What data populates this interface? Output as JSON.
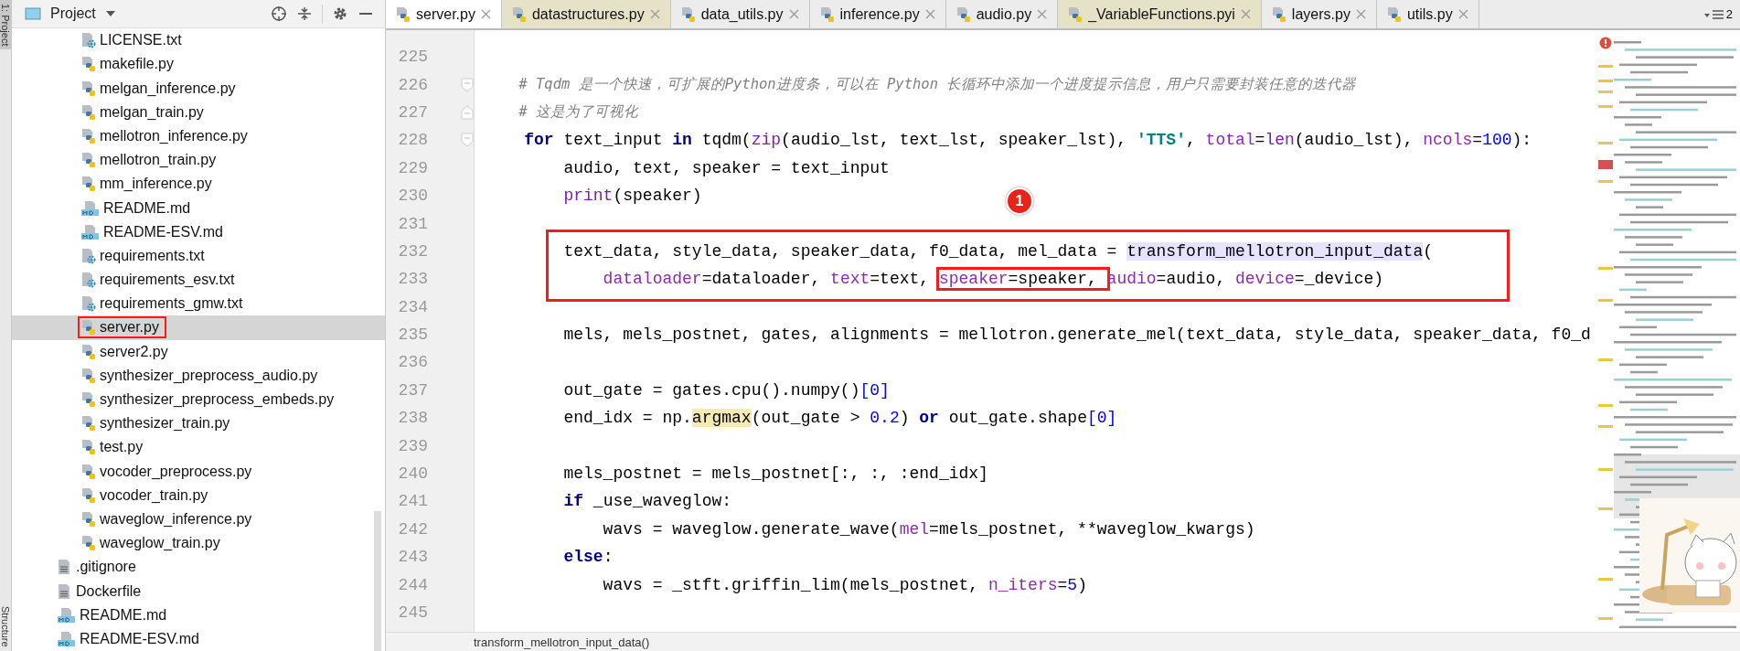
{
  "tool_strip": {
    "top_label": "1: Project",
    "bottom_label": "Structure"
  },
  "project_panel": {
    "title": "Project",
    "inner_items": [
      {
        "label": "LICENSE.txt",
        "kind": "config",
        "selected": false,
        "boxed": false
      },
      {
        "label": "makefile.py",
        "kind": "python",
        "selected": false,
        "boxed": false
      },
      {
        "label": "melgan_inference.py",
        "kind": "python",
        "selected": false,
        "boxed": false
      },
      {
        "label": "melgan_train.py",
        "kind": "python",
        "selected": false,
        "boxed": false
      },
      {
        "label": "mellotron_inference.py",
        "kind": "python",
        "selected": false,
        "boxed": false
      },
      {
        "label": "mellotron_train.py",
        "kind": "python",
        "selected": false,
        "boxed": false
      },
      {
        "label": "mm_inference.py",
        "kind": "python",
        "selected": false,
        "boxed": false
      },
      {
        "label": "README.md",
        "kind": "markdown",
        "selected": false,
        "boxed": false
      },
      {
        "label": "README-ESV.md",
        "kind": "markdown",
        "selected": false,
        "boxed": false
      },
      {
        "label": "requirements.txt",
        "kind": "config",
        "selected": false,
        "boxed": false
      },
      {
        "label": "requirements_esv.txt",
        "kind": "config",
        "selected": false,
        "boxed": false
      },
      {
        "label": "requirements_gmw.txt",
        "kind": "config",
        "selected": false,
        "boxed": false
      },
      {
        "label": "server.py",
        "kind": "python",
        "selected": true,
        "boxed": true
      },
      {
        "label": "server2.py",
        "kind": "python",
        "selected": false,
        "boxed": false
      },
      {
        "label": "synthesizer_preprocess_audio.py",
        "kind": "python",
        "selected": false,
        "boxed": false
      },
      {
        "label": "synthesizer_preprocess_embeds.py",
        "kind": "python",
        "selected": false,
        "boxed": false
      },
      {
        "label": "synthesizer_train.py",
        "kind": "python",
        "selected": false,
        "boxed": false
      },
      {
        "label": "test.py",
        "kind": "python",
        "selected": false,
        "boxed": false
      },
      {
        "label": "vocoder_preprocess.py",
        "kind": "python",
        "selected": false,
        "boxed": false
      },
      {
        "label": "vocoder_train.py",
        "kind": "python",
        "selected": false,
        "boxed": false
      },
      {
        "label": "waveglow_inference.py",
        "kind": "python",
        "selected": false,
        "boxed": false
      },
      {
        "label": "waveglow_train.py",
        "kind": "python",
        "selected": false,
        "boxed": false
      }
    ],
    "outer_items": [
      {
        "label": ".gitignore",
        "kind": "text",
        "selected": false,
        "boxed": false
      },
      {
        "label": "Dockerfile",
        "kind": "text",
        "selected": false,
        "boxed": false
      },
      {
        "label": "README.md",
        "kind": "markdown",
        "selected": false,
        "boxed": false
      },
      {
        "label": "README-ESV.md",
        "kind": "markdown",
        "selected": false,
        "boxed": false
      }
    ]
  },
  "tabs": [
    {
      "label": "server.py",
      "selected": true,
      "library": false
    },
    {
      "label": "datastructures.py",
      "selected": false,
      "library": true
    },
    {
      "label": "data_utils.py",
      "selected": false,
      "library": false
    },
    {
      "label": "inference.py",
      "selected": false,
      "library": false
    },
    {
      "label": "audio.py",
      "selected": false,
      "library": false
    },
    {
      "label": "_VariableFunctions.pyi",
      "selected": false,
      "library": true
    },
    {
      "label": "layers.py",
      "selected": false,
      "library": false
    },
    {
      "label": "utils.py",
      "selected": false,
      "library": false
    }
  ],
  "hidden_tabs_count": "2",
  "editor": {
    "lines": [
      {
        "number": "225"
      },
      {
        "number": "226",
        "fold_open": true,
        "segments": [
          {
            "text": "    # Tqdm 是一个快速，可扩展的Python进度条，可以在 Python 长循环中添加一个进度提示信息，用户只需要封装任意的迭代器",
            "kind": "comment"
          }
        ]
      },
      {
        "number": "227",
        "fold_close": true,
        "segments": [
          {
            "text": "    # 这是为了可视化",
            "kind": "comment"
          }
        ]
      },
      {
        "number": "228",
        "fold_open": true,
        "segments": [
          {
            "text": "    for",
            "kind": "keyword"
          },
          {
            "text": " text_input ",
            "kind": "plain"
          },
          {
            "text": "in",
            "kind": "keyword"
          },
          {
            "text": " tqdm(",
            "kind": "plain"
          },
          {
            "text": "zip",
            "kind": "builtin"
          },
          {
            "text": "(audio_lst, text_lst, speaker_lst), ",
            "kind": "plain"
          },
          {
            "text": "'TTS'",
            "kind": "string"
          },
          {
            "text": ", ",
            "kind": "plain"
          },
          {
            "text": "total",
            "kind": "kwarg"
          },
          {
            "text": "=",
            "kind": "plain"
          },
          {
            "text": "len",
            "kind": "builtin"
          },
          {
            "text": "(audio_lst), ",
            "kind": "plain"
          },
          {
            "text": "ncols",
            "kind": "kwarg"
          },
          {
            "text": "=",
            "kind": "plain"
          },
          {
            "text": "100",
            "kind": "number"
          },
          {
            "text": "):",
            "kind": "plain"
          }
        ]
      },
      {
        "number": "229",
        "segments": [
          {
            "text": "        audio, text, speaker = text_input",
            "kind": "plain"
          }
        ]
      },
      {
        "number": "230",
        "segments": [
          {
            "text": "        print",
            "kind": "builtin"
          },
          {
            "text": "(speaker)",
            "kind": "plain"
          }
        ]
      },
      {
        "number": "231"
      },
      {
        "number": "232",
        "boxed": true,
        "segments": [
          {
            "text": "        text_data, style_data, speaker_data, f0_data, mel_data = ",
            "kind": "plain"
          },
          {
            "text": "transform_mellotron_input_data",
            "kind": "call"
          },
          {
            "text": "(",
            "kind": "plain"
          }
        ]
      },
      {
        "number": "233",
        "boxed": true,
        "segments": [
          {
            "text": "            dataloader",
            "kind": "kwarg"
          },
          {
            "text": "=dataloader, ",
            "kind": "plain"
          },
          {
            "text": "text",
            "kind": "kwarg"
          },
          {
            "text": "=text, ",
            "kind": "plain"
          },
          {
            "text": "speaker",
            "kind": "kwarg",
            "boxed": true
          },
          {
            "text": "=speaker, ",
            "kind": "plain",
            "boxed": true
          },
          {
            "text": "audio",
            "kind": "kwarg"
          },
          {
            "text": "=audio, ",
            "kind": "plain"
          },
          {
            "text": "device",
            "kind": "kwarg"
          },
          {
            "text": "=_device)",
            "kind": "plain"
          }
        ]
      },
      {
        "number": "234"
      },
      {
        "number": "235",
        "segments": [
          {
            "text": "        mels, mels_postnet, gates, alignments = mellotron.generate_mel(text_data, style_data, speaker_data, f0_d",
            "kind": "plain"
          }
        ]
      },
      {
        "number": "236"
      },
      {
        "number": "237",
        "segments": [
          {
            "text": "        out_gate = gates.cpu().numpy()",
            "kind": "plain"
          },
          {
            "text": "[0]",
            "kind": "number"
          }
        ]
      },
      {
        "number": "238",
        "segments": [
          {
            "text": "        end_idx = np.",
            "kind": "plain"
          },
          {
            "text": "argmax",
            "kind": "usage"
          },
          {
            "text": "(out_gate > ",
            "kind": "plain"
          },
          {
            "text": "0.2",
            "kind": "number"
          },
          {
            "text": ") ",
            "kind": "plain"
          },
          {
            "text": "or",
            "kind": "keyword"
          },
          {
            "text": " out_gate.shape",
            "kind": "plain"
          },
          {
            "text": "[0]",
            "kind": "number"
          }
        ]
      },
      {
        "number": "239"
      },
      {
        "number": "240",
        "segments": [
          {
            "text": "        mels_postnet = mels_postnet[:, :, :end_idx]",
            "kind": "plain"
          }
        ]
      },
      {
        "number": "241",
        "segments": [
          {
            "text": "        if",
            "kind": "keyword"
          },
          {
            "text": " _use_waveglow:",
            "kind": "plain"
          }
        ]
      },
      {
        "number": "242",
        "segments": [
          {
            "text": "            wavs = waveglow.generate_wave(",
            "kind": "plain"
          },
          {
            "text": "mel",
            "kind": "kwarg"
          },
          {
            "text": "=mels_postnet, **waveglow_kwargs)",
            "kind": "plain"
          }
        ]
      },
      {
        "number": "243",
        "segments": [
          {
            "text": "        else",
            "kind": "keyword"
          },
          {
            "text": ":",
            "kind": "plain"
          }
        ]
      },
      {
        "number": "244",
        "segments": [
          {
            "text": "            wavs = _stft.griffin_lim(mels_postnet, ",
            "kind": "plain"
          },
          {
            "text": "n_iters",
            "kind": "kwarg"
          },
          {
            "text": "=",
            "kind": "plain"
          },
          {
            "text": "5",
            "kind": "number"
          },
          {
            "text": ")",
            "kind": "plain"
          }
        ]
      },
      {
        "number": "245"
      }
    ],
    "marker": "1",
    "breadcrumb": "transform_mellotron_input_data()"
  }
}
